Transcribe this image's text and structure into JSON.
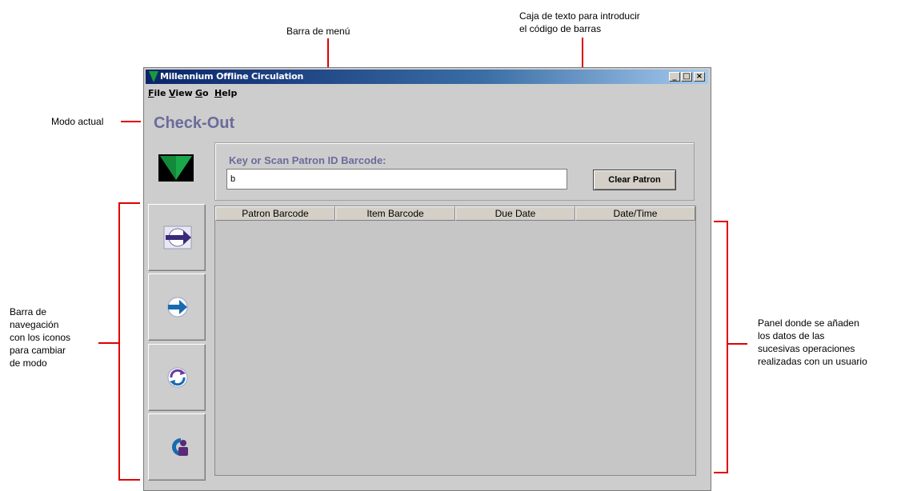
{
  "annotations": {
    "menu_bar": "Barra de menú",
    "text_box": "Caja de texto para introducir\nel código de barras",
    "current_mode": "Modo actual",
    "nav_bar": "Barra de\nnavegación\ncon los iconos\npara cambiar\nde modo",
    "panel": "Panel donde se añaden\nlos datos de las\nsucesivas operaciones\nrealizadas con un usuario"
  },
  "window": {
    "title": "Millennium Offline Circulation",
    "controls": {
      "minimize": "_",
      "maximize": "□",
      "close": "×"
    }
  },
  "menu": {
    "items": [
      "File",
      "View",
      "Go",
      "Help"
    ]
  },
  "mode": {
    "title": "Check-Out"
  },
  "patron": {
    "label": "Key or Scan Patron ID Barcode:",
    "input_value": "b",
    "clear_button": "Clear Patron"
  },
  "nav": {
    "icons": [
      "check-out-icon",
      "check-in-icon",
      "renew-icon",
      "patron-icon"
    ]
  },
  "table": {
    "columns": [
      "Patron Barcode",
      "Item Barcode",
      "Due Date",
      "Date/Time"
    ],
    "rows": []
  },
  "colors": {
    "accent_text": "#6b6b9c",
    "annotation_line": "#e00000",
    "title_bar": "#0a246a",
    "window_bg": "#cdcdcd"
  }
}
